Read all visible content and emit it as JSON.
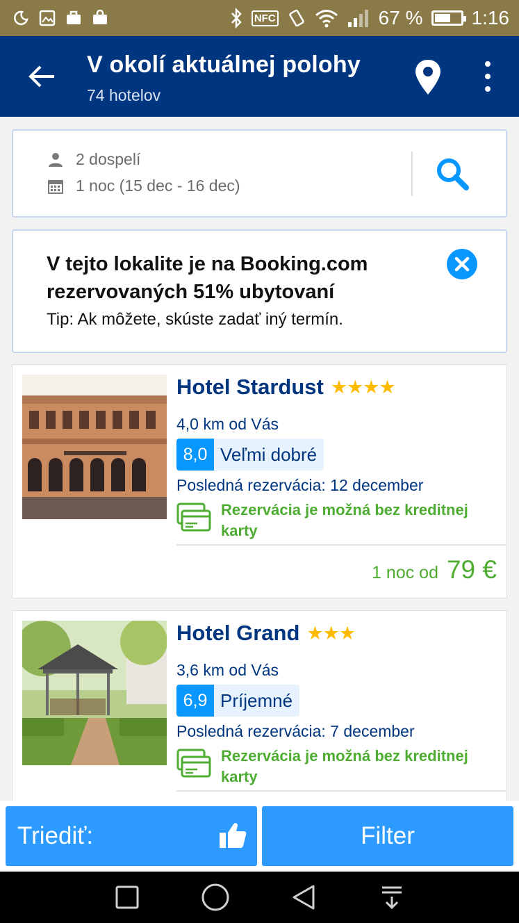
{
  "status_bar": {
    "battery_text": "67 %",
    "battery_level": 0.67,
    "time": "1:16",
    "nfc_label": "NFC"
  },
  "app_bar": {
    "title": "V okolí aktuálnej polohy",
    "subtitle": "74 hotelov"
  },
  "search": {
    "guests": "2 dospelí",
    "dates": "1 noc (15 dec - 16 dec)"
  },
  "info": {
    "title": "V tejto lokalite je na Booking.com rezervovaných 51% ubytovaní",
    "tip": "Tip: Ak môžete, skúste zadať iný termín."
  },
  "hotels": [
    {
      "name": "Hotel Stardust",
      "stars": "★★★★",
      "distance": "4,0 km od Vás",
      "score": "8,0",
      "score_label": "Veľmi dobré",
      "last_booking": "Posledná rezervácia: 12 december",
      "no_card": "Rezervácia je možná bez kreditnej karty",
      "price_label": "1 noc od",
      "price": "79 €"
    },
    {
      "name": "Hotel Grand",
      "stars": "★★★",
      "distance": "3,6 km od Vás",
      "score": "6,9",
      "score_label": "Príjemné",
      "last_booking": "Posledná rezervácia: 7 december",
      "no_card": "Rezervácia je možná bez kreditnej karty"
    }
  ],
  "bottom": {
    "sort_label": "Triediť:",
    "filter_label": "Filter"
  },
  "colors": {
    "brand_dark": "#003580",
    "brand_blue": "#0896ff",
    "button_blue": "#2c9aff",
    "green": "#4fac32",
    "star_yellow": "#febb02"
  }
}
